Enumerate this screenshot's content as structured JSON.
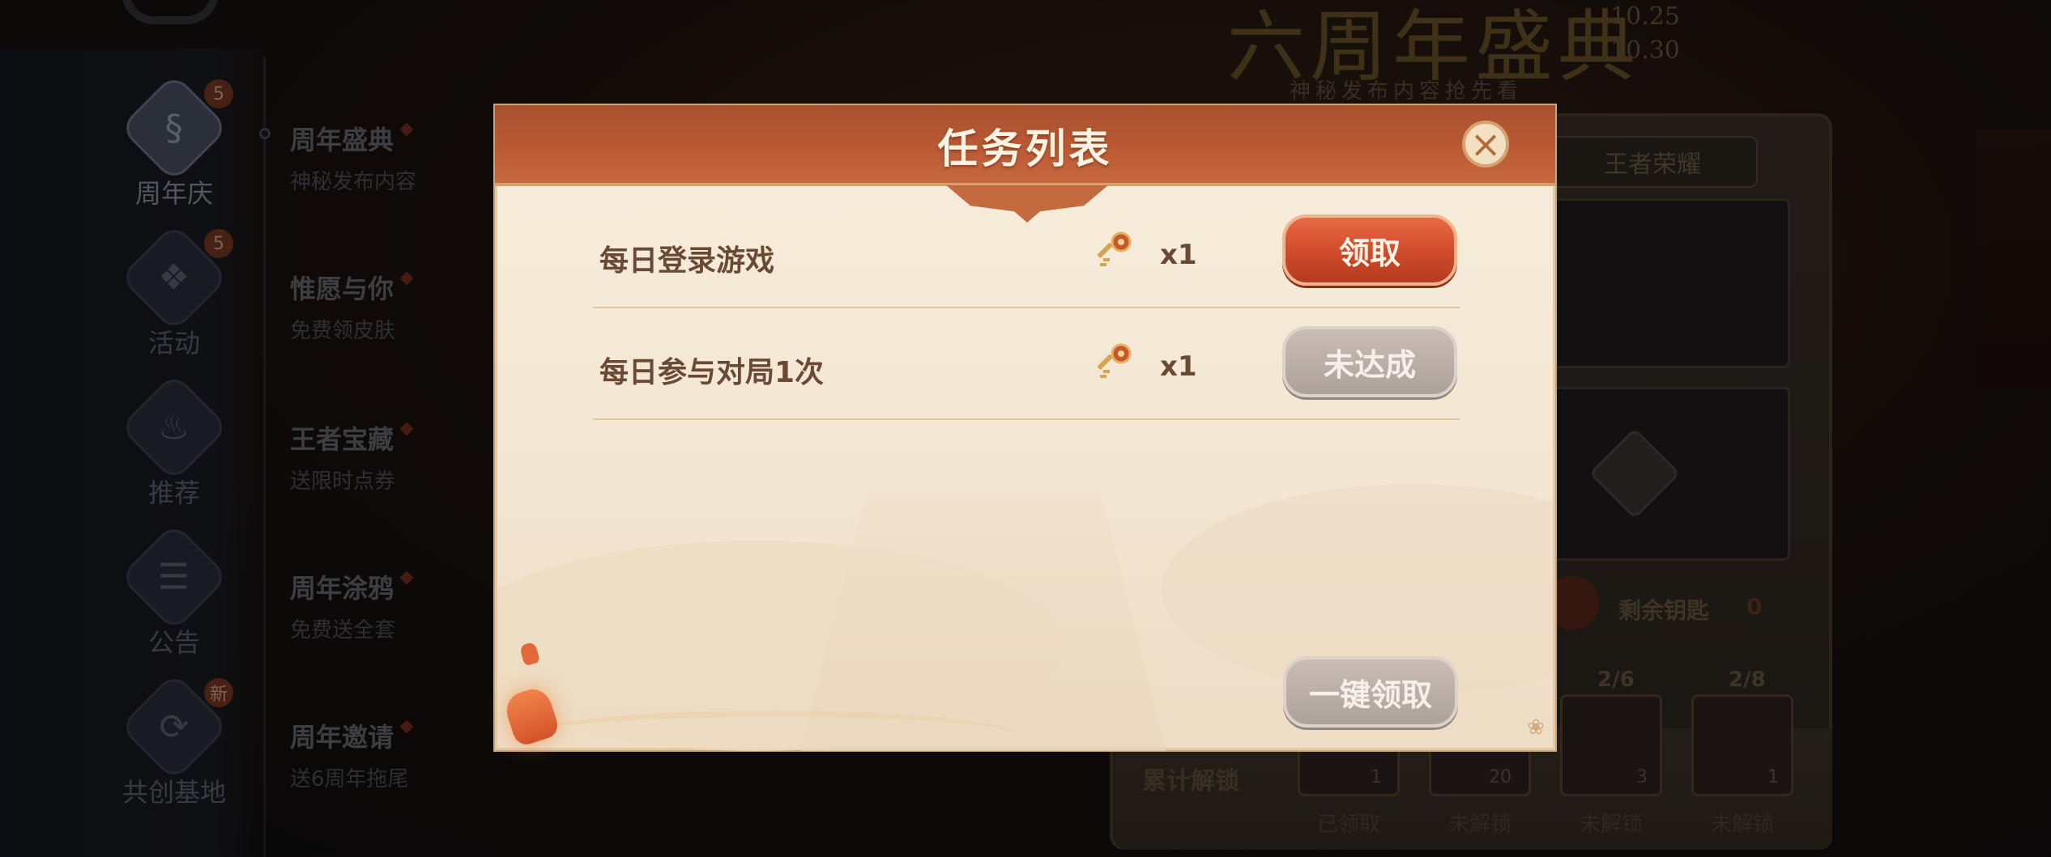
{
  "background": {
    "banner": {
      "title": "六周年盛典",
      "date_start": "10.25",
      "date_end": "10.30",
      "subtitle": "神秘发布内容抢先看"
    },
    "nav_items": [
      {
        "label": "周年庆",
        "badge": "5",
        "icon": "anniversary-icon",
        "active": true
      },
      {
        "label": "活动",
        "badge": "5",
        "icon": "gift-icon",
        "active": false
      },
      {
        "label": "推荐",
        "badge": "",
        "icon": "flame-icon",
        "active": false
      },
      {
        "label": "公告",
        "badge": "",
        "icon": "notice-icon",
        "active": false
      },
      {
        "label": "共创基地",
        "badge": "新",
        "icon": "sync-icon",
        "active": false
      }
    ],
    "sub_items": [
      {
        "title": "周年盛典",
        "desc": "神秘发布内容"
      },
      {
        "title": "惟愿与你",
        "desc": "免费领皮肤"
      },
      {
        "title": "王者宝藏",
        "desc": "送限时点券"
      },
      {
        "title": "周年涂鸦",
        "desc": "免费送全套"
      },
      {
        "title": "周年邀请",
        "desc": "送6周年拖尾"
      }
    ],
    "panel_tab": "王者荣耀",
    "remaining_keys_label": "剩余钥匙",
    "remaining_keys_count": "0",
    "unlock_label": "累计解锁",
    "rewards": [
      {
        "progress": "",
        "count": "1",
        "state": "已领取"
      },
      {
        "progress": "",
        "count": "20",
        "state": "未解锁"
      },
      {
        "progress": "2/6",
        "count": "3",
        "state": "未解锁"
      },
      {
        "progress": "2/8",
        "count": "1",
        "state": "未解锁"
      }
    ]
  },
  "modal": {
    "title": "任务列表",
    "close_icon": "close-icon",
    "tasks": [
      {
        "name": "每日登录游戏",
        "reward_icon": "key-icon",
        "reward_qty": "x1",
        "action_label": "领取",
        "action_state": "claimable"
      },
      {
        "name": "每日参与对局1次",
        "reward_icon": "key-icon",
        "reward_qty": "x1",
        "action_label": "未达成",
        "action_state": "incomplete"
      }
    ],
    "claim_all_label": "一键领取",
    "colors": {
      "header": "#b95a35",
      "claim_button": "#cf4a2a",
      "disabled_button": "#ada29b",
      "body": "#f5e9d6"
    }
  }
}
